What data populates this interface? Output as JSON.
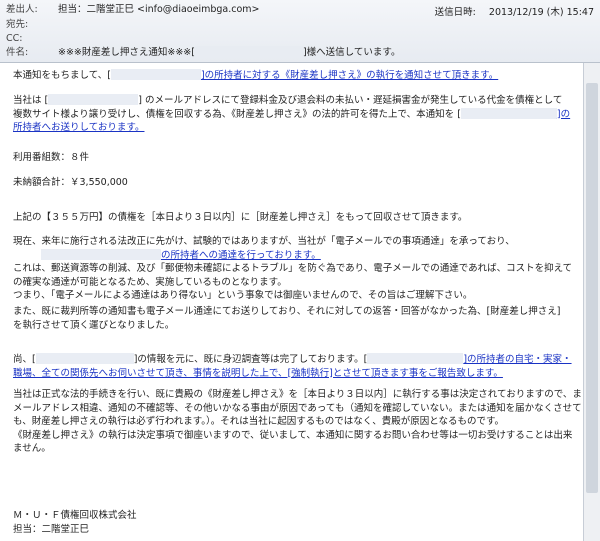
{
  "header": {
    "from_label": "差出人:",
    "from_value": "担当：二階堂正巳 <info@diaoeimbga.com>",
    "to_label": "宛先:",
    "cc_label": "CC:",
    "subject_label": "件名:",
    "subject_prefix": "※※※財産差し押さえ通知※※※[",
    "subject_suffix": "]様へ送信しています。",
    "sent_label": "送信日時:",
    "sent_value": "2013/12/19 (木) 15:47"
  },
  "body": {
    "p1_a": "本通知をもちまして、[",
    "p1_b": "]の所持者に対する《財産差し押さえ》の執行を通知させて頂きます。",
    "p2_a": "当社は [",
    "p2_b": "] のメールアドレスにて登録料金及び退会料の未払い・遅延損害金が発生している代金を債権として",
    "p2_c": "複数サイト様より譲り受けし、債権を回収する為、《財産差し押さえ》の法的許可を得た上で、本通知を [",
    "p2_d": "]の",
    "p2_e": "所持者へお送りしております。",
    "count": "利用番組数：８件",
    "total": "未納額合計：￥3,550,000",
    "p3": "上記の【３５５万円】の債権を［本日より３日以内］に［財産差し押さえ］をもって回収させて頂きます。",
    "p4_a": "現在、来年に施行される法改正に先がけ、試験的ではありますが、当社が「電子メールでの事項通達」を承っており、",
    "p4_b": "の所持者への通達を行っております。",
    "p4_c": "これは、郵送資源等の削減、及び「郵便物未確認によるトラブル」を防ぐ為であり、電子メールでの通達であれば、コストを抑えて",
    "p4_d": "の確実な通達が可能となるため、実施しているものとなります。",
    "p4_e": "つまり、「電子メールによる通達はあり得ない」という事象では御座いませんので、その旨はご理解下さい。",
    "p5_a": "また、既に裁判所等の通知書も電子メール通達にてお送りしており、それに対しての返答・回答がなかった為、[財産差し押さえ]",
    "p5_b": "を執行させて頂く運びとなりました。",
    "p6_a": "尚、[",
    "p6_b": "]の情報を元に、既に身辺調査等は完了しております。[",
    "p6_c": "]の所持者の自宅・実家・",
    "p6_d": "職場、全ての関係先へお伺いさせて頂き、事情を説明した上で、[強制執行]とさせて頂きます事をご報告致します。",
    "p7_a": "当社は正式な法的手続きを行い、既に貴殿の《財産差し押さえ》を［本日より３日以内］に執行する事は決定されておりますので、ま",
    "p7_b": "メールアドレス相違、通知の不確認等、その他いかなる事由が原因であっても（通知を確認していない。または通知を届かなくさせて",
    "p7_c": "も、財産差し押さえの執行は必ず行われます。）。それは当社に起因するものではなく、貴殿が原因となるものです。",
    "p7_d": "《財産差し押さえ》の執行は決定事項で御座いますので、従いまして、本通知に関するお問い合わせ等は一切お受けすることは出来",
    "p7_e": "ません。",
    "sig_company": "Ｍ・Ｕ・Ｆ債権回収株式会社",
    "sig_person": "担当：二階堂正巳"
  }
}
